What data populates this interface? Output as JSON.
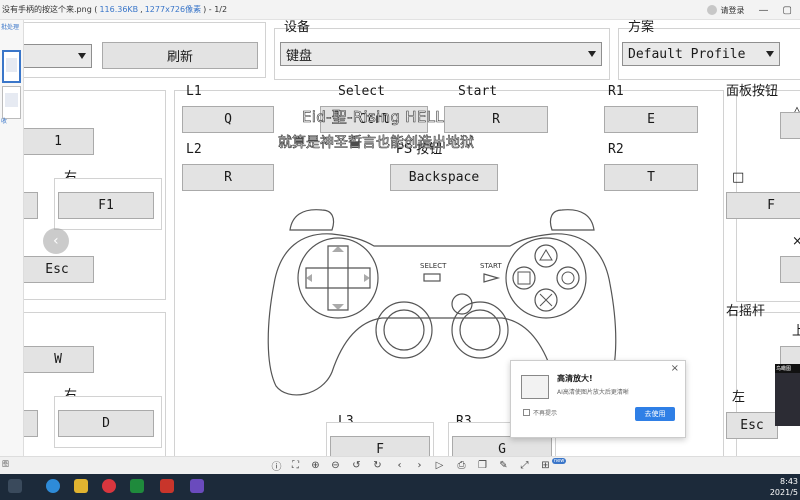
{
  "viewer": {
    "title_prefix": "没有手柄的按这个来.png (",
    "file_size": "116.36KB",
    "sep": " , ",
    "resolution": "1277x726像素",
    "title_suffix": ") - 1/2",
    "login": "请登录",
    "minimize": "—",
    "restore": "▢",
    "thumb_top_label": "批处理",
    "thumb_mid_label": "收"
  },
  "config": {
    "device_label": "设备",
    "device_value": "键盘",
    "scheme_label": "方案",
    "scheme_value": "Default Profile",
    "refresh": "刷新",
    "l1_label": "L1",
    "l1_key": "Q",
    "l2_label": "L2",
    "l2_key": "R",
    "select_label": "Select",
    "select_key": "Ctrl",
    "start_label": "Start",
    "start_key": "R",
    "ps_label": "PS 按钮",
    "ps_key": "Backspace",
    "r1_label": "R1",
    "r1_key": "E",
    "r2_label": "R2",
    "r2_key": "T",
    "face_label": "面板按钮",
    "face_square_glyph": "□",
    "face_triangle_glyph": "△",
    "face_cross_glyph": "×",
    "face_square_key": "F",
    "left_key_1": "1",
    "right_label_1": "右",
    "right_key_1": "F1",
    "esc_key": "Esc",
    "w_key": "W",
    "right_label_2": "右",
    "d_key": "D",
    "right_stick_label": "右摇杆",
    "rs_up_label": "上",
    "rs_left_label": "左",
    "rs_left_key": "Esc",
    "l3_label": "L3",
    "l3_key": "F",
    "r3_label": "R3",
    "r3_key": "G",
    "controller_select": "SELECT",
    "controller_start": "START"
  },
  "overlay": {
    "line1": "Eid-聖-Rising HELL",
    "line2": "就算是神圣誓言也能创造出地狱"
  },
  "popup": {
    "title": "高清放大!",
    "subtitle": "AI高清使图片放大后更清晰",
    "no_remind": "不再提示",
    "go": "去使用",
    "close": "×"
  },
  "preview": {
    "caption": "鸟瞰图"
  },
  "toolbar": {
    "new_badge": "new",
    "left_label": "图"
  },
  "tray": {
    "time": "8:43",
    "date": "2021/5"
  }
}
